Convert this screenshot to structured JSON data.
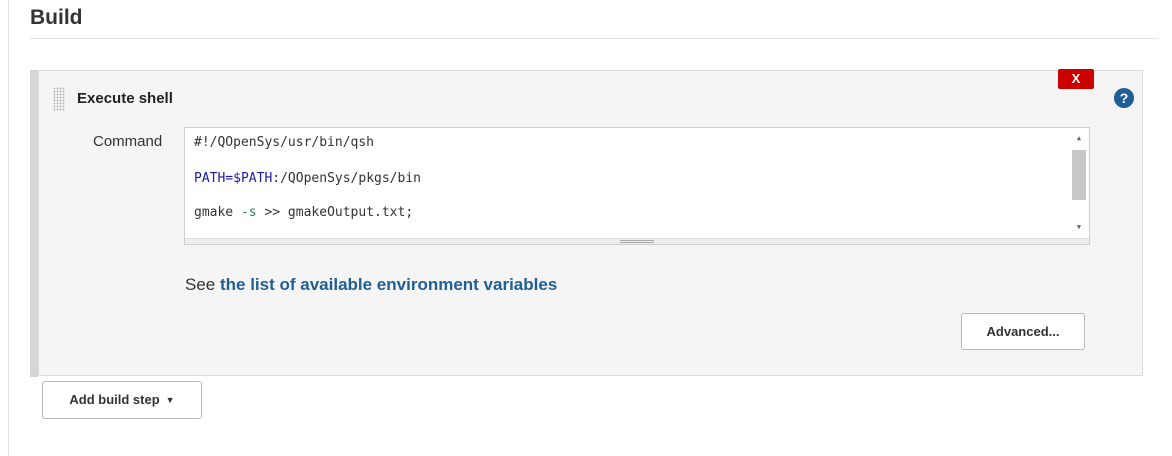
{
  "section": {
    "title": "Build"
  },
  "step": {
    "title": "Execute shell",
    "delete_label": "X",
    "help_label": "?",
    "command_label": "Command",
    "code": {
      "line1": "#!/QOpenSys/usr/bin/qsh",
      "line2_var": "PATH=$PATH",
      "line2_rest": ":/QOpenSys/pkgs/bin",
      "line3_a": "gmake ",
      "line3_flag": "-s",
      "line3_b": " >> gmakeOutput.txt;"
    },
    "env_prefix": "See ",
    "env_link": "the list of available environment variables",
    "advanced_label": "Advanced..."
  },
  "add_step": {
    "label": "Add build step"
  },
  "colors": {
    "delete": "#cc0000",
    "link": "#1f5f95",
    "help": "#1f5f95"
  }
}
